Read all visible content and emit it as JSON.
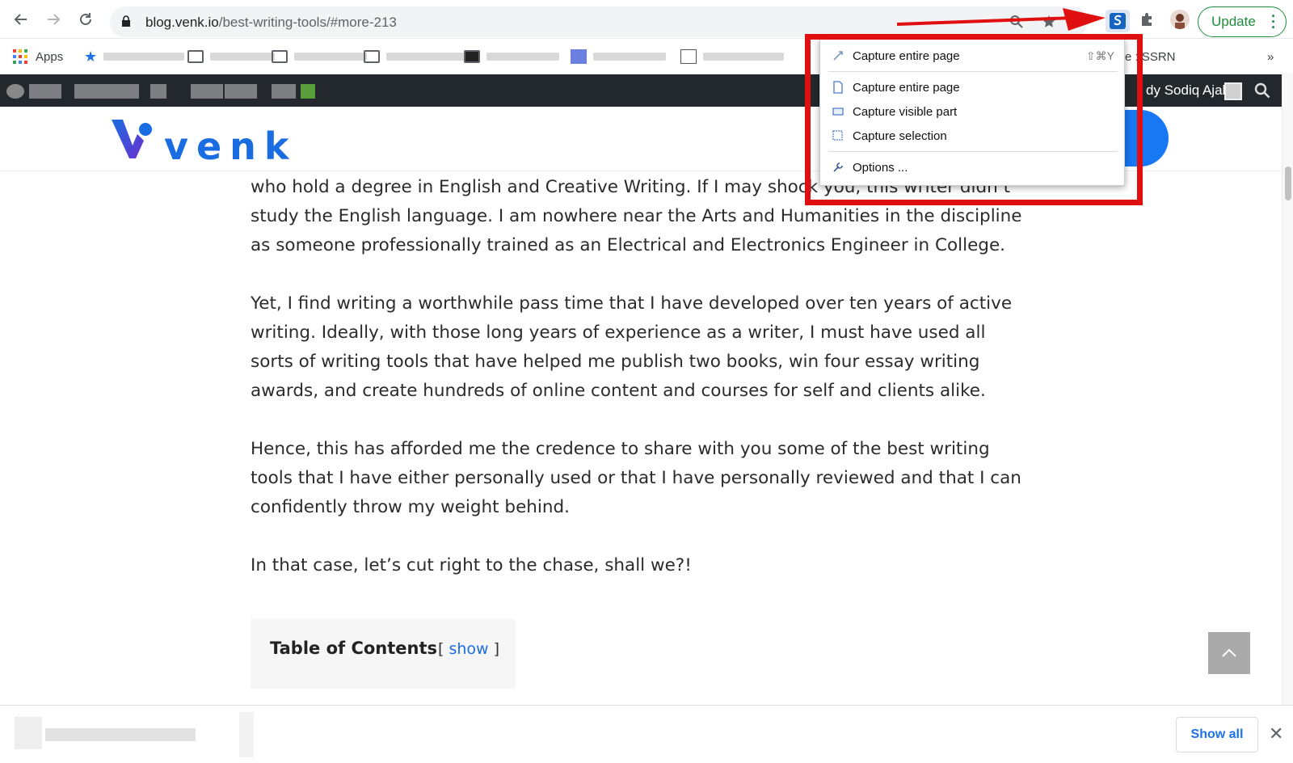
{
  "browser": {
    "url_host": "blog.venk.io",
    "url_path": "/best-writing-tools/#more-213",
    "update_label": "Update"
  },
  "bookmarks": {
    "apps_label": "Apps",
    "visible_right": "e : SSRN",
    "overflow": "»"
  },
  "admin_bar": {
    "user_prefix": "dy",
    "user_name": "Sodiq Ajala"
  },
  "site": {
    "logo_text": "venk"
  },
  "article": {
    "paragraphs": [
      "who hold a degree in English and Creative Writing. If I may shock you, this writer didn’t study the English language. I am nowhere near the Arts and Humanities in the discipline as someone professionally trained as an Electrical and Electronics Engineer in College.",
      "Yet, I find writing a worthwhile pass time that I have developed over ten years of active writing. Ideally, with those long years of experience as a writer, I must have used all sorts of writing tools that have helped me publish two books, win four essay writing awards, and create hundreds of online content and courses for self and clients alike.",
      "Hence, this has afforded me the credence to share with you some of the best writing tools that I have either personally used or that I have personally reviewed and that I can confidently throw my weight behind.",
      "In that case, let’s cut right to the chase, shall we?!"
    ],
    "toc_title": "Table of Contents",
    "toc_bracket_open": "[ ",
    "toc_show": "show",
    "toc_bracket_close": " ]"
  },
  "extension_menu": {
    "items": [
      {
        "label": "Capture entire page",
        "shortcut": "⇧⌘Y",
        "icon": "capture-fast-icon"
      },
      {
        "label": "Capture entire page",
        "icon": "page-icon"
      },
      {
        "label": "Capture visible part",
        "icon": "visible-icon"
      },
      {
        "label": "Capture selection",
        "icon": "selection-icon"
      },
      {
        "label": "Options ...",
        "icon": "tools-icon"
      }
    ]
  },
  "download_bar": {
    "show_all_label": "Show all",
    "close_glyph": "✕"
  },
  "colors": {
    "annotation_red": "#e01010",
    "brand_blue": "#1a6de0",
    "update_green": "#1e8e3e"
  }
}
